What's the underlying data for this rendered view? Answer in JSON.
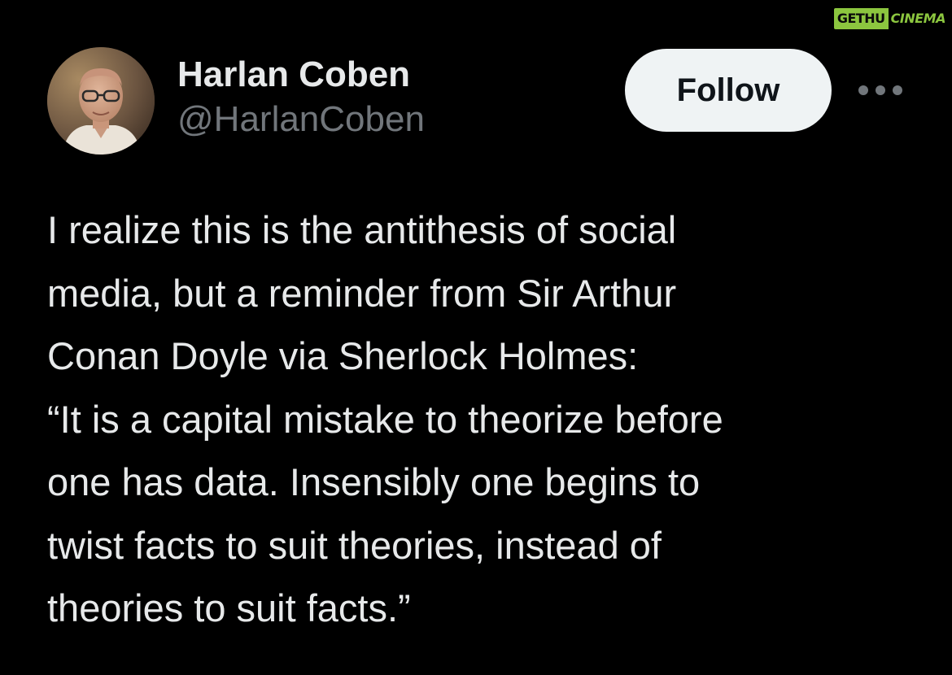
{
  "watermark": {
    "part1": "GETHU",
    "part2": "",
    "part3": "CINEMA"
  },
  "author": {
    "display_name": "Harlan Coben",
    "handle": "@HarlanCoben",
    "avatar_icon": "avatar-photo"
  },
  "actions": {
    "follow_label": "Follow",
    "more_icon": "more-horizontal-icon"
  },
  "tweet": {
    "text": "I realize this is the antithesis of social\nmedia, but a reminder from Sir Arthur\nConan Doyle via Sherlock Holmes:\n“It is a capital mistake to theorize before\none has data. Insensibly one begins to\ntwist facts to suit theories, instead of\ntheories to suit facts.”"
  },
  "colors": {
    "background": "#000000",
    "primary_text": "#e7e9ea",
    "secondary_text": "#71767b",
    "follow_bg": "#eff3f4",
    "follow_text": "#0f1419",
    "watermark_green": "#8cc63f"
  }
}
